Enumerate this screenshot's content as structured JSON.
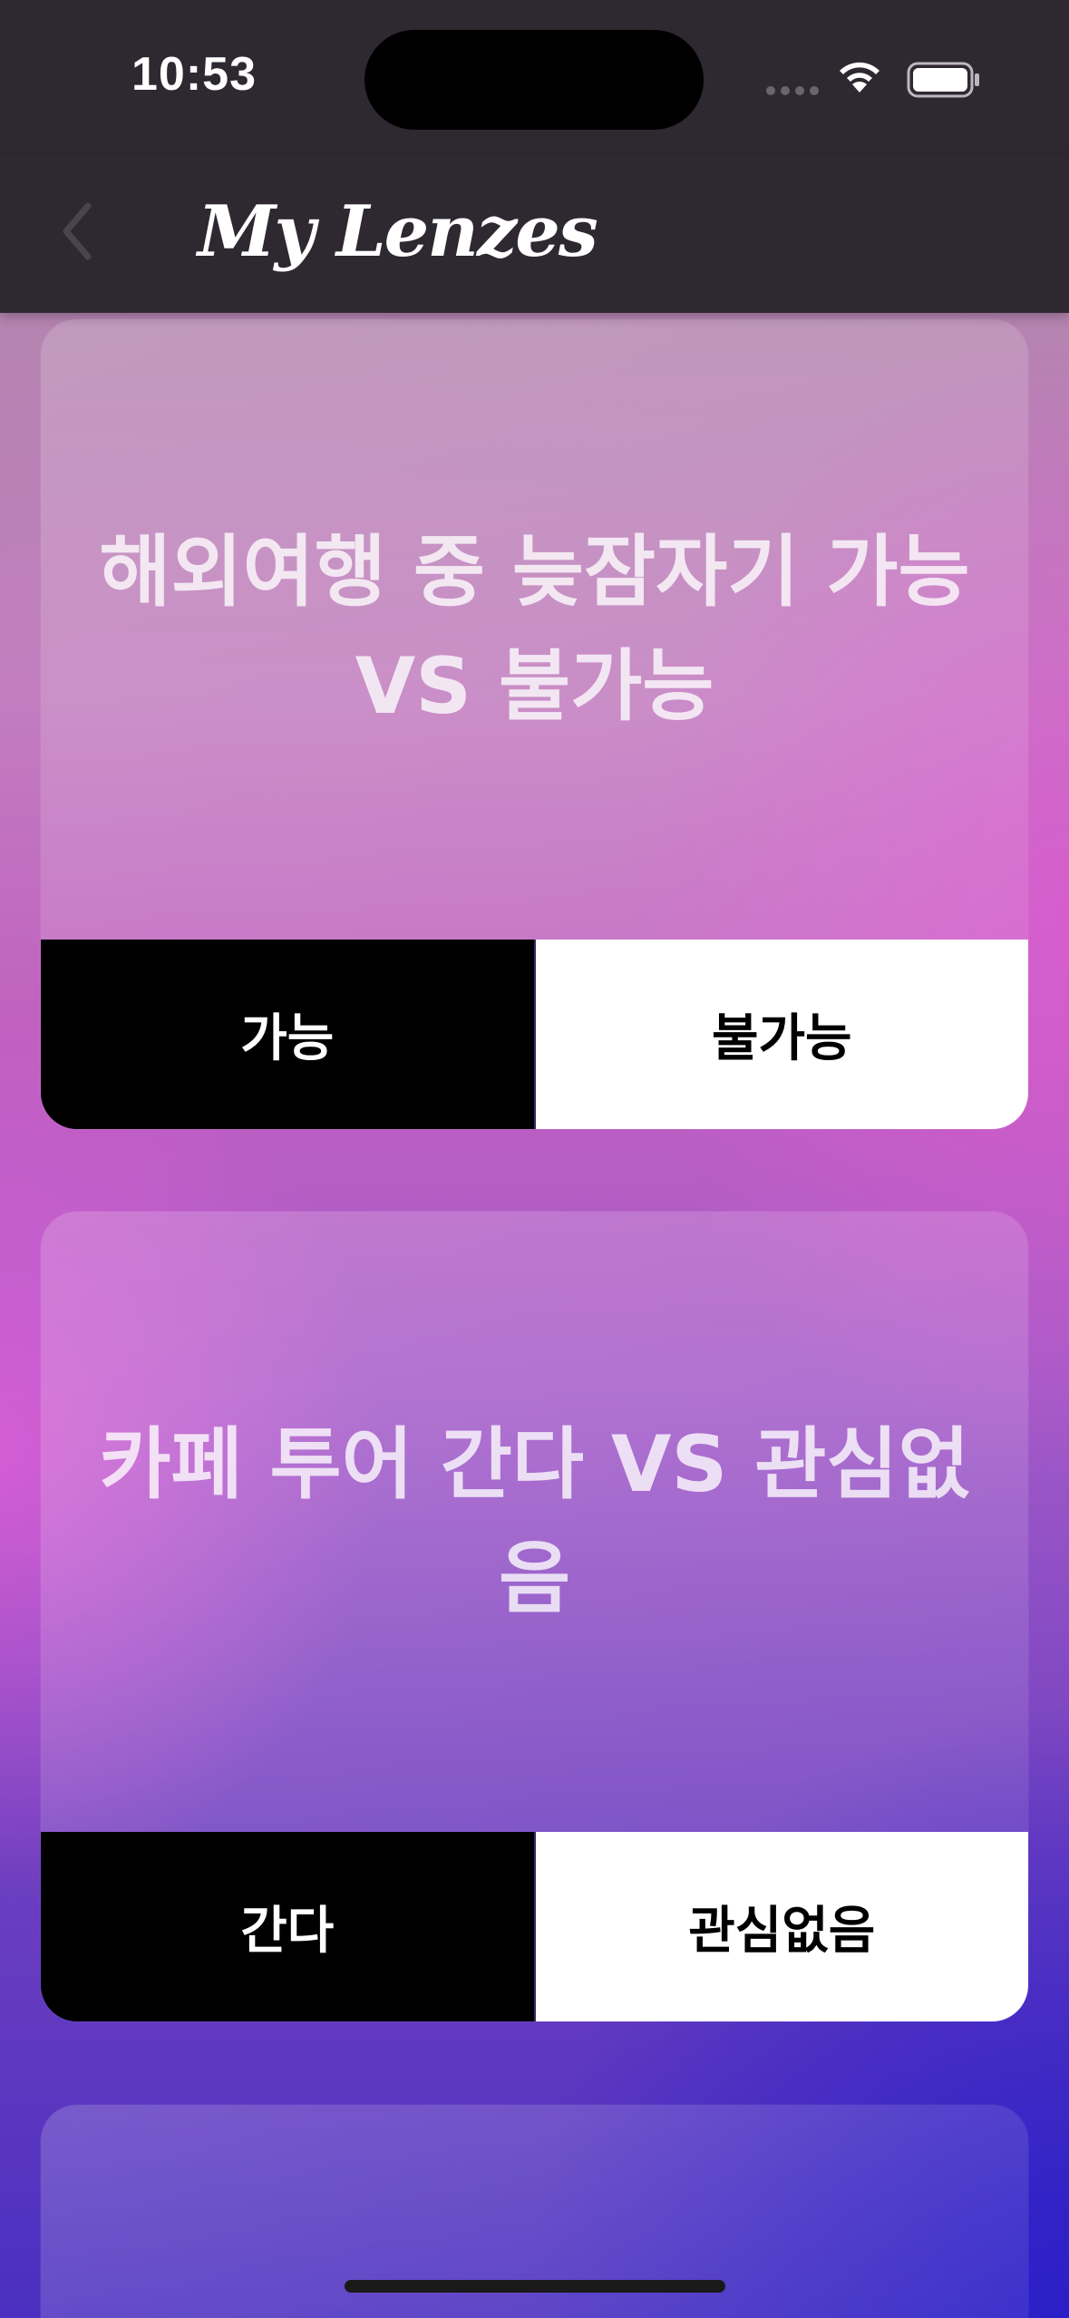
{
  "status_bar": {
    "time": "10:53"
  },
  "nav": {
    "title": "My Lenzes",
    "back_icon": "chevron-left-icon"
  },
  "cards": [
    {
      "question": "해외여행 중 늦잠자기 가능 VS 불가능",
      "option_a": "가능",
      "option_b": "불가능"
    },
    {
      "question": "카페 투어 간다 VS 관심없음",
      "option_a": "간다",
      "option_b": "관심없음"
    }
  ],
  "colors": {
    "nav_bg": "#2e2831",
    "option_a_bg": "#000000",
    "option_b_bg": "#ffffff"
  }
}
